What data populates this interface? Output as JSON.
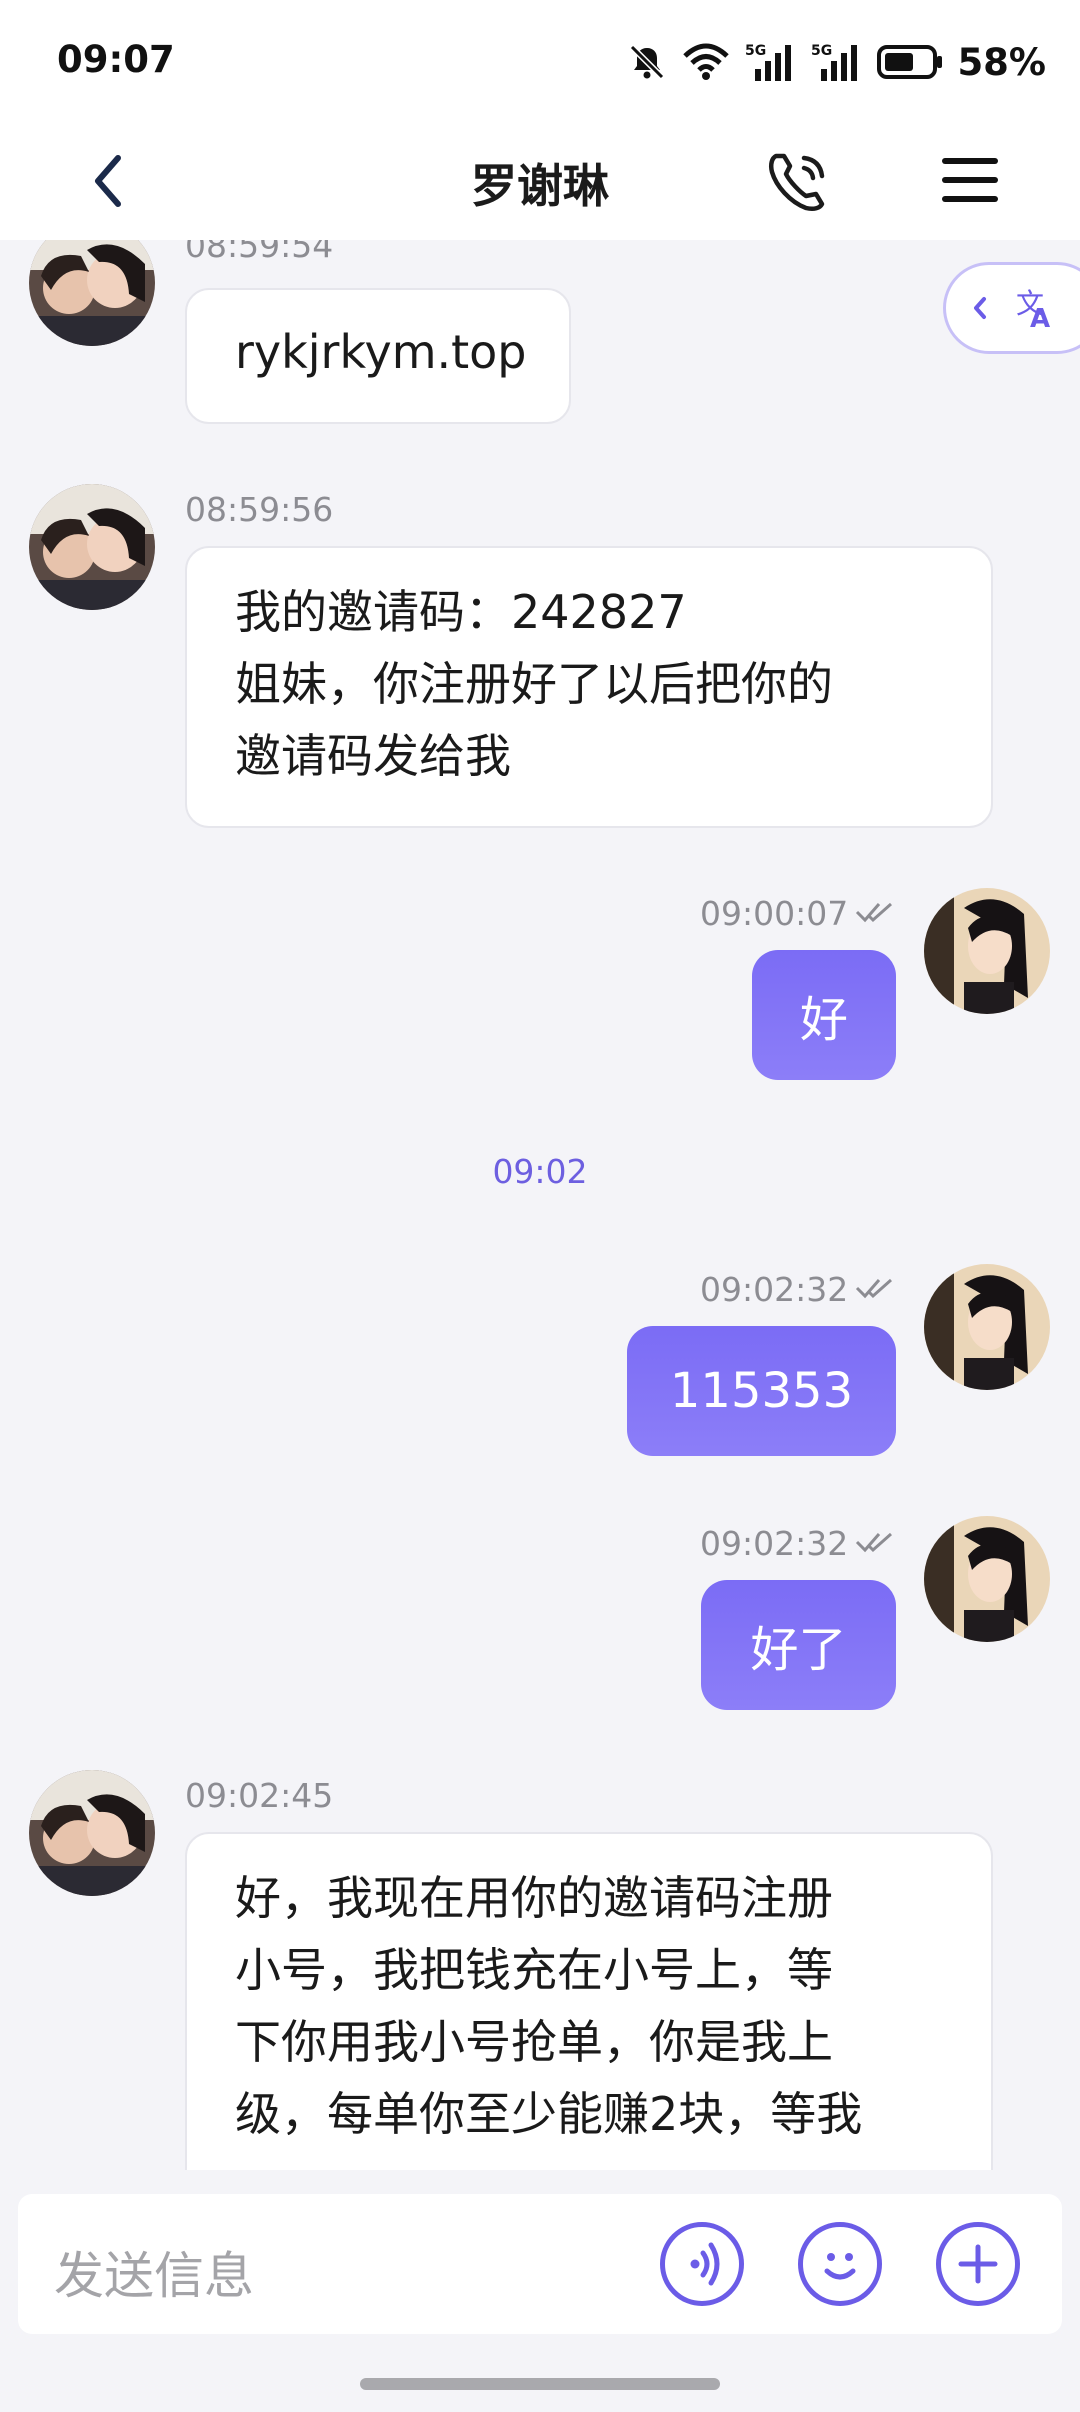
{
  "status_bar": {
    "time": "09:07",
    "battery": "58%",
    "icons": [
      "mute-icon",
      "wifi-icon",
      "signal-5g-icon",
      "signal-5g-icon",
      "battery-icon"
    ]
  },
  "header": {
    "title": "罗谢琳",
    "back_icon": "chevron-left-icon",
    "call_icon": "phone-icon",
    "menu_icon": "hamburger-icon"
  },
  "translate_button": {
    "icon": "translate-icon"
  },
  "messages": [
    {
      "side": "in",
      "time": "08:59:54",
      "lines": [
        "rykjrkym.top"
      ]
    },
    {
      "side": "in",
      "time": "08:59:56",
      "lines": [
        "我的邀请码：242827",
        "姐妹，你注册好了以后把你的",
        "邀请码发给我"
      ]
    },
    {
      "side": "out",
      "time": "09:00:07",
      "text": "好"
    },
    {
      "side": "divider",
      "time": "09:02"
    },
    {
      "side": "out",
      "time": "09:02:32",
      "text": "115353"
    },
    {
      "side": "out",
      "time": "09:02:32",
      "text": "好了"
    },
    {
      "side": "in",
      "time": "09:02:45",
      "lines": [
        "好，我现在用你的邀请码注册",
        "小号，我把钱充在小号上，等",
        "下你用我小号抢单，你是我上",
        "级，每单你至少能赚2块，等我"
      ]
    }
  ],
  "input": {
    "placeholder": "发送信息",
    "voice_icon": "voice-icon",
    "emoji_icon": "smiley-icon",
    "add_icon": "plus-icon"
  },
  "colors": {
    "accent": "#6b5ce7",
    "bubble_out": "#7b6cf5",
    "bubble_in": "#ffffff",
    "background": "#f4f4f8"
  }
}
